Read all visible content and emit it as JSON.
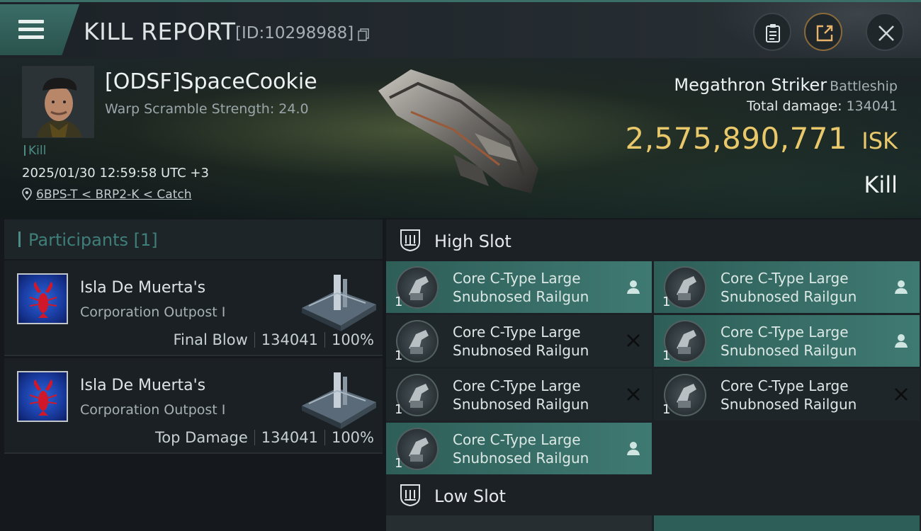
{
  "header": {
    "title": "KILL REPORT",
    "report_id": "[ID:10298988]"
  },
  "victim": {
    "name": "[ODSF]SpaceCookie",
    "scramble": "Warp Scramble Strength: 24.0",
    "tag": "Kill",
    "timestamp": "2025/01/30 12:59:58 UTC +3",
    "location": "6BPS-T < BRP2-K < Catch",
    "ship_name": "Megathron Striker",
    "ship_class": "Battleship",
    "damage_label": "Total damage:",
    "damage_value": "134041",
    "isk_value": "2,575,890,771",
    "isk_unit": "ISK",
    "result": "Kill"
  },
  "participants": {
    "header": "Participants [1]",
    "rows": [
      {
        "name": "Isla De Muerta's",
        "type": "Corporation Outpost I",
        "role": "Final Blow",
        "damage": "134041",
        "percent": "100%"
      },
      {
        "name": "Isla De Muerta's",
        "type": "Corporation Outpost I",
        "role": "Top Damage",
        "damage": "134041",
        "percent": "100%"
      }
    ]
  },
  "slots": {
    "high_label": "High Slot",
    "low_label": "Low Slot",
    "modules": [
      {
        "name": "Core C-Type Large Snubnosed Railgun",
        "qty": "1",
        "state": "fitted"
      },
      {
        "name": "Core C-Type Large Snubnosed Railgun",
        "qty": "1",
        "state": "fitted"
      },
      {
        "name": "Core C-Type Large Snubnosed Railgun",
        "qty": "1",
        "state": "dropped"
      },
      {
        "name": "Core C-Type Large Snubnosed Railgun",
        "qty": "1",
        "state": "fitted"
      },
      {
        "name": "Core C-Type Large Snubnosed Railgun",
        "qty": "1",
        "state": "dropped"
      },
      {
        "name": "Core C-Type Large Snubnosed Railgun",
        "qty": "1",
        "state": "dropped"
      },
      {
        "name": "Core C-Type Large Snubnosed Railgun",
        "qty": "1",
        "state": "fitted"
      }
    ]
  },
  "colors": {
    "accent": "#3f7a72",
    "isk": "#e8c86a"
  }
}
